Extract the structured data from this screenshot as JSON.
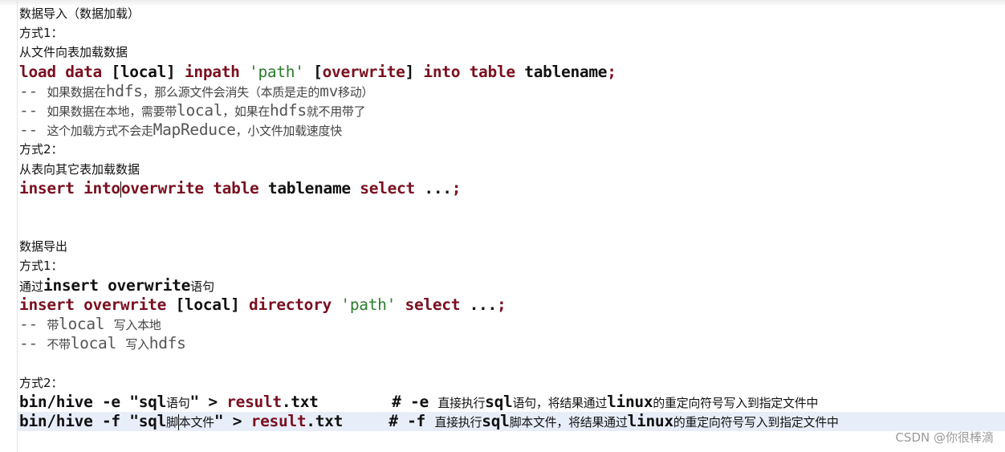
{
  "lines": [
    [
      {
        "t": "数据导入（数据加载）",
        "c": "plain"
      }
    ],
    [
      {
        "t": "方式1：",
        "c": "plain"
      }
    ],
    [
      {
        "t": "从文件向表加载数据",
        "c": "plain"
      }
    ],
    [
      {
        "t": "load data ",
        "c": "kw"
      },
      {
        "t": "[local] ",
        "c": "txt"
      },
      {
        "t": "inpath ",
        "c": "kw"
      },
      {
        "t": "'path'",
        "c": "str"
      },
      {
        "t": " [",
        "c": "txt"
      },
      {
        "t": "overwrite",
        "c": "kw"
      },
      {
        "t": "] ",
        "c": "txt"
      },
      {
        "t": "into table ",
        "c": "kw"
      },
      {
        "t": "tablename",
        "c": "txt"
      },
      {
        "t": ";",
        "c": "kw"
      }
    ],
    [
      {
        "t": "-- ",
        "c": "cm"
      },
      {
        "t": "如果数据在",
        "c": "cmz"
      },
      {
        "t": "hdfs",
        "c": "cm"
      },
      {
        "t": "，那么源文件会消失（本质是走的",
        "c": "cmz"
      },
      {
        "t": "mv",
        "c": "cm"
      },
      {
        "t": "移动）",
        "c": "cmz"
      }
    ],
    [
      {
        "t": "-- ",
        "c": "cm"
      },
      {
        "t": "如果数据在本地，需要带",
        "c": "cmz"
      },
      {
        "t": "local",
        "c": "cm"
      },
      {
        "t": "，如果在",
        "c": "cmz"
      },
      {
        "t": "hdfs",
        "c": "cm"
      },
      {
        "t": "就不用带了",
        "c": "cmz"
      }
    ],
    [
      {
        "t": "-- ",
        "c": "cm"
      },
      {
        "t": "这个加载方式不会走",
        "c": "cmz"
      },
      {
        "t": "MapReduce",
        "c": "cm"
      },
      {
        "t": "，小文件加载速度快",
        "c": "cmz"
      }
    ],
    [
      {
        "t": "方式2：",
        "c": "plain"
      }
    ],
    [
      {
        "t": "从表向其它表加载数据",
        "c": "plain"
      }
    ],
    [
      {
        "t": "insert into",
        "c": "kw"
      },
      {
        "t": "",
        "c": "caret"
      },
      {
        "t": "overwrite table ",
        "c": "kw"
      },
      {
        "t": "tablename ",
        "c": "txt"
      },
      {
        "t": "select ",
        "c": "kw"
      },
      {
        "t": "...",
        "c": "txt"
      },
      {
        "t": ";",
        "c": "kw"
      }
    ],
    [],
    [],
    [
      {
        "t": "数据导出",
        "c": "plain"
      }
    ],
    [
      {
        "t": "方式1：",
        "c": "plain"
      }
    ],
    [
      {
        "t": "通过",
        "c": "plain"
      },
      {
        "t": "insert overwrite",
        "c": "txt"
      },
      {
        "t": "语句",
        "c": "plain"
      }
    ],
    [
      {
        "t": "insert overwrite ",
        "c": "kw"
      },
      {
        "t": "[local] ",
        "c": "txt"
      },
      {
        "t": "directory ",
        "c": "kw"
      },
      {
        "t": "'path'",
        "c": "str"
      },
      {
        "t": " ",
        "c": "txt"
      },
      {
        "t": "select ",
        "c": "kw"
      },
      {
        "t": "...",
        "c": "txt"
      },
      {
        "t": ";",
        "c": "kw"
      }
    ],
    [
      {
        "t": "-- ",
        "c": "cm"
      },
      {
        "t": "带",
        "c": "cmz"
      },
      {
        "t": "local ",
        "c": "cm"
      },
      {
        "t": "写入本地",
        "c": "cmz"
      }
    ],
    [
      {
        "t": "-- ",
        "c": "cm"
      },
      {
        "t": "不带",
        "c": "cmz"
      },
      {
        "t": "local ",
        "c": "cm"
      },
      {
        "t": "写入",
        "c": "cmz"
      },
      {
        "t": "hdfs",
        "c": "cm"
      }
    ],
    [],
    [
      {
        "t": "方式2：",
        "c": "plain"
      }
    ],
    [
      {
        "t": "bin/hive -e \"sql",
        "c": "txt"
      },
      {
        "t": "语句",
        "c": "zh"
      },
      {
        "t": "\" > ",
        "c": "txt"
      },
      {
        "t": "result",
        "c": "kw"
      },
      {
        "t": ".txt        # -e ",
        "c": "txt"
      },
      {
        "t": "直接执行",
        "c": "zh"
      },
      {
        "t": "sql",
        "c": "txt"
      },
      {
        "t": "语句，将结果通过",
        "c": "zh"
      },
      {
        "t": "linux",
        "c": "txt"
      },
      {
        "t": "的重定向符号写入到指定文件中",
        "c": "zh"
      }
    ],
    [
      {
        "t": "bin/hive -f \"sql",
        "c": "txt"
      },
      {
        "t": "脚",
        "c": "zh"
      },
      {
        "t": "",
        "c": "caret"
      },
      {
        "t": "本文件",
        "c": "zh"
      },
      {
        "t": "\" > ",
        "c": "txt"
      },
      {
        "t": "result",
        "c": "kw"
      },
      {
        "t": ".txt     # -f ",
        "c": "txt"
      },
      {
        "t": "直接执行",
        "c": "zh"
      },
      {
        "t": "sql",
        "c": "txt"
      },
      {
        "t": "脚本文件，将结果通过",
        "c": "zh"
      },
      {
        "t": "linux",
        "c": "txt"
      },
      {
        "t": "的重定向符号写入到指定文件中",
        "c": "zh"
      }
    ]
  ],
  "highlighted_line": 21,
  "watermark": "CSDN @你很棒滴",
  "colors": {
    "keyword": "#7a1020",
    "string": "#2a7d2a",
    "comment": "#555555",
    "highlight": "#e8eef9"
  }
}
